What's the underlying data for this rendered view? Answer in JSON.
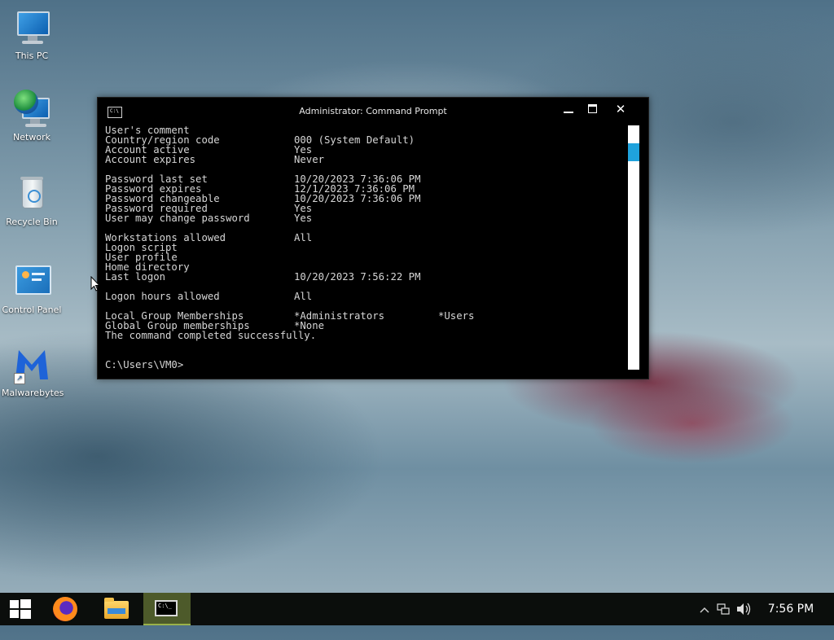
{
  "desktop": {
    "icons": [
      {
        "label": "This PC"
      },
      {
        "label": "Network"
      },
      {
        "label": "Recycle Bin"
      },
      {
        "label": "Control Panel"
      },
      {
        "label": "Malwarebytes"
      }
    ]
  },
  "window": {
    "title": "Administrator: Command Prompt",
    "icon_text": "C:\\",
    "buttons": {
      "minimize": "minimize",
      "maximize": "maximize",
      "close": "✕"
    }
  },
  "console": {
    "lines": [
      {
        "key": "User's comment",
        "value": "",
        "value2": ""
      },
      {
        "key": "Country/region code",
        "value": "000 (System Default)",
        "value2": ""
      },
      {
        "key": "Account active",
        "value": "Yes",
        "value2": ""
      },
      {
        "key": "Account expires",
        "value": "Never",
        "value2": ""
      },
      {
        "key": "",
        "value": "",
        "value2": ""
      },
      {
        "key": "Password last set",
        "value": "10/20/2023 7:36:06 PM",
        "value2": ""
      },
      {
        "key": "Password expires",
        "value": "12/1/2023 7:36:06 PM",
        "value2": ""
      },
      {
        "key": "Password changeable",
        "value": "10/20/2023 7:36:06 PM",
        "value2": ""
      },
      {
        "key": "Password required",
        "value": "Yes",
        "value2": ""
      },
      {
        "key": "User may change password",
        "value": "Yes",
        "value2": ""
      },
      {
        "key": "",
        "value": "",
        "value2": ""
      },
      {
        "key": "Workstations allowed",
        "value": "All",
        "value2": ""
      },
      {
        "key": "Logon script",
        "value": "",
        "value2": ""
      },
      {
        "key": "User profile",
        "value": "",
        "value2": ""
      },
      {
        "key": "Home directory",
        "value": "",
        "value2": ""
      },
      {
        "key": "Last logon",
        "value": "10/20/2023 7:56:22 PM",
        "value2": ""
      },
      {
        "key": "",
        "value": "",
        "value2": ""
      },
      {
        "key": "Logon hours allowed",
        "value": "All",
        "value2": ""
      },
      {
        "key": "",
        "value": "",
        "value2": ""
      },
      {
        "key": "Local Group Memberships",
        "value": "*Administrators",
        "value2": "*Users"
      },
      {
        "key": "Global Group memberships",
        "value": "*None",
        "value2": ""
      },
      {
        "key": "The command completed successfully.",
        "value": "",
        "value2": ""
      },
      {
        "key": "",
        "value": "",
        "value2": ""
      },
      {
        "key": "",
        "value": "",
        "value2": ""
      },
      {
        "key": "C:\\Users\\VM0>",
        "value": "",
        "value2": ""
      }
    ]
  },
  "taskbar": {
    "items": [
      "start-icon",
      "firefox-icon",
      "file-explorer-icon",
      "command-prompt-icon"
    ],
    "cmd_icon_text": "C:\\_",
    "tray": {
      "chevron": "^",
      "network": "network-icon",
      "volume": "volume-icon"
    },
    "clock": "7:56 PM"
  }
}
